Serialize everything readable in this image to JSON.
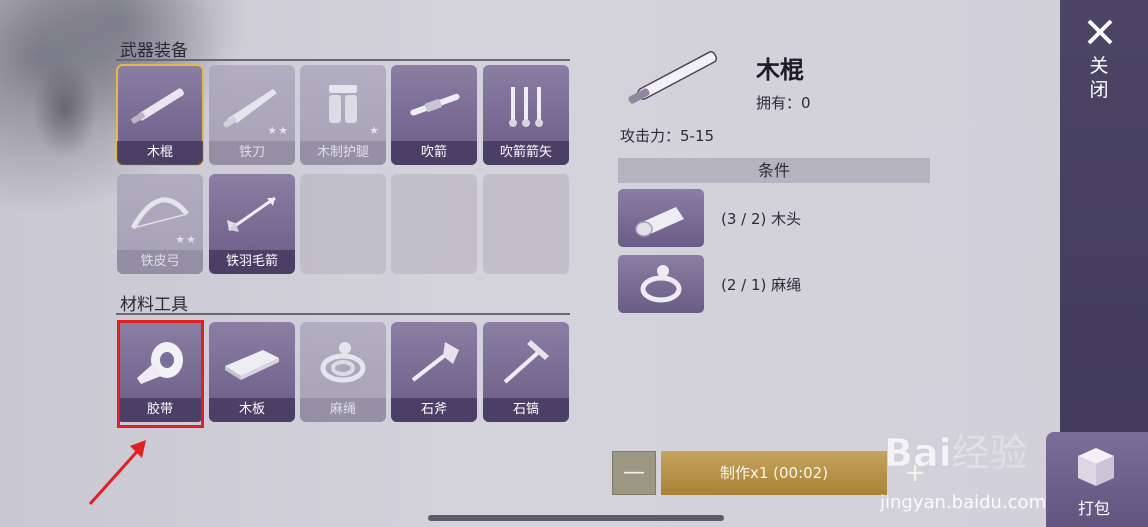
{
  "sections": {
    "weapons_title": "武器装备",
    "materials_title": "材料工具"
  },
  "weapons": [
    {
      "label": "木棍",
      "icon": "wooden-stick-icon",
      "state": "selected",
      "stars": ""
    },
    {
      "label": "铁刀",
      "icon": "iron-knife-icon",
      "state": "locked",
      "stars": "★★"
    },
    {
      "label": "木制护腿",
      "icon": "wooden-leggings-icon",
      "state": "locked",
      "stars": "★"
    },
    {
      "label": "吹箭",
      "icon": "blowgun-icon",
      "state": "available",
      "stars": ""
    },
    {
      "label": "吹箭箭矢",
      "icon": "blowgun-darts-icon",
      "state": "available",
      "stars": ""
    },
    {
      "label": "铁皮弓",
      "icon": "iron-bow-icon",
      "state": "locked",
      "stars": "★★"
    },
    {
      "label": "铁羽毛箭",
      "icon": "iron-feather-arrow-icon",
      "state": "available",
      "stars": ""
    }
  ],
  "materials": [
    {
      "label": "胶带",
      "icon": "tape-roll-icon",
      "state": "available"
    },
    {
      "label": "木板",
      "icon": "wooden-plank-icon",
      "state": "available"
    },
    {
      "label": "麻绳",
      "icon": "hemp-rope-icon",
      "state": "locked"
    },
    {
      "label": "石斧",
      "icon": "stone-axe-icon",
      "state": "available"
    },
    {
      "label": "石镐",
      "icon": "stone-pickaxe-icon",
      "state": "available"
    }
  ],
  "detail": {
    "name": "木棍",
    "owned": "拥有：0",
    "attack": "攻击力：5-15",
    "conditions_title": "条件",
    "requirements": [
      {
        "text": "(3 / 2) 木头",
        "icon": "log-icon"
      },
      {
        "text": "(2 / 1) 麻绳",
        "icon": "hemp-rope-icon"
      }
    ]
  },
  "craft": {
    "minus": "—",
    "button": "制作x1 (00:02)",
    "plus": "+"
  },
  "side": {
    "close": "关闭",
    "pack": "打包"
  },
  "watermark": {
    "brand": "Bai经验",
    "url": "jingyan.baidu.com"
  },
  "colors": {
    "tile_active": "#7a6e96",
    "selected_outline": "#e8b64a",
    "highlight_box": "#e01f1f",
    "craft_button": "#b8944a",
    "side_panel": "#463f60"
  }
}
